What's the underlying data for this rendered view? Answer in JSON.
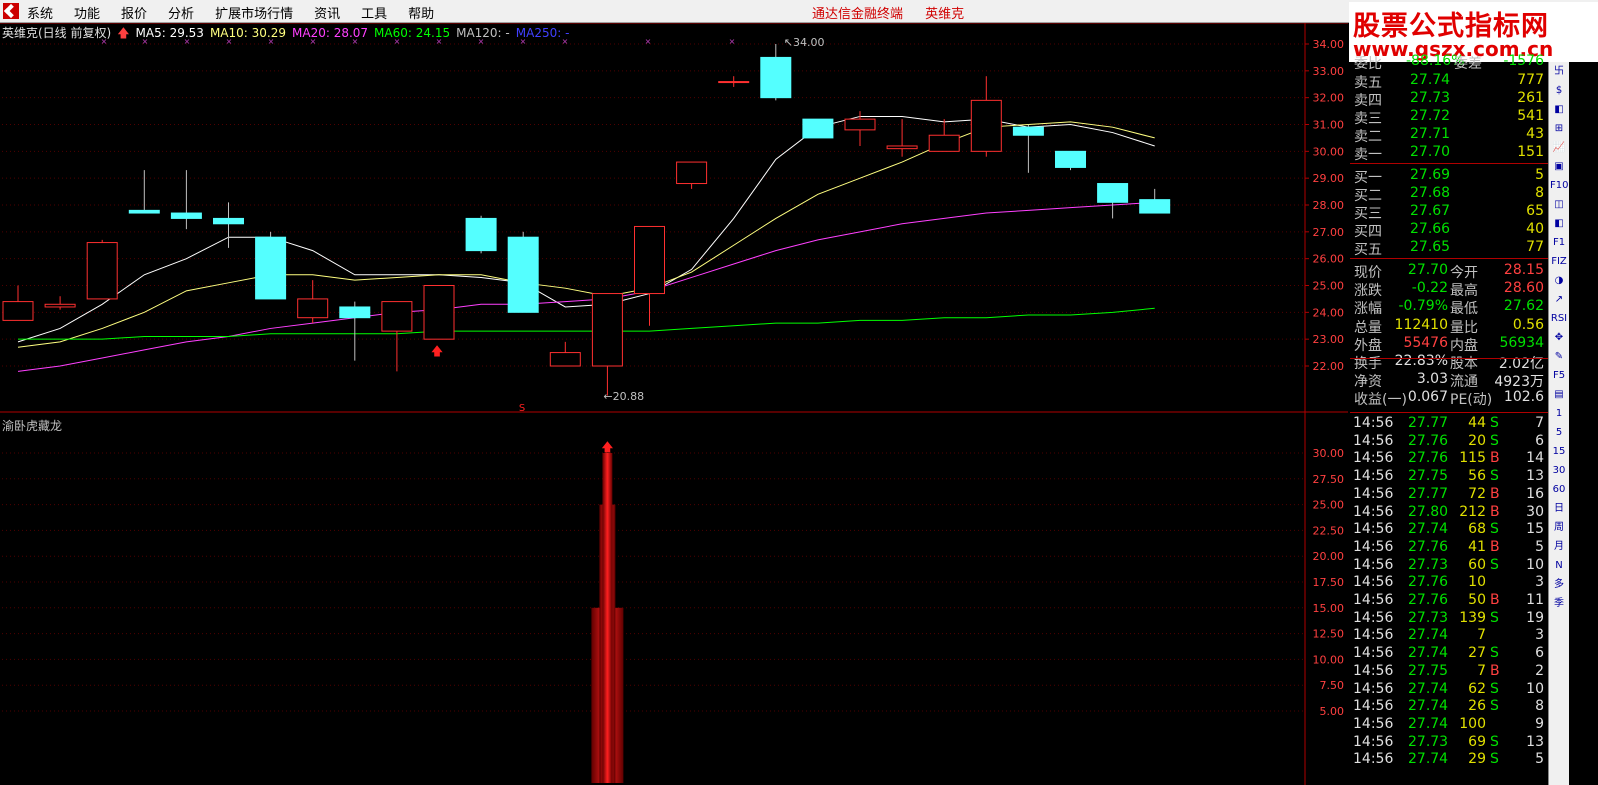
{
  "menu": {
    "items": [
      "系统",
      "功能",
      "报价",
      "分析",
      "扩展市场行情",
      "资讯",
      "工具",
      "帮助"
    ],
    "center_title": "通达信金融终端",
    "stock_name": "英维克"
  },
  "brand": {
    "title": "股票公式指标网",
    "url": "www.gszx.com.cn"
  },
  "chart": {
    "header": "英维克(日线 前复权)",
    "ma": [
      {
        "label": "MA5: 29.53",
        "color": "#ffffff"
      },
      {
        "label": "MA10: 30.29",
        "color": "#ffff80"
      },
      {
        "label": "MA20: 28.07",
        "color": "#ff40ff"
      },
      {
        "label": "MA60: 24.15",
        "color": "#00ff00"
      },
      {
        "label": "MA120: -",
        "color": "#c0c0c0"
      },
      {
        "label": "MA250: -",
        "color": "#4040ff"
      }
    ],
    "price_axis": [
      "34.00",
      "33.00",
      "32.00",
      "31.00",
      "30.00",
      "29.00",
      "28.00",
      "27.00",
      "26.00",
      "25.00",
      "24.00",
      "23.00",
      "22.00"
    ],
    "high_label": "34.00",
    "low_label": "20.88",
    "indicator_title": "渝卧虎藏龙",
    "indicator_axis": [
      "30.00",
      "27.50",
      "25.00",
      "22.50",
      "20.00",
      "17.50",
      "15.00",
      "12.50",
      "10.00",
      "7.50",
      "5.00"
    ]
  },
  "chart_data": {
    "type": "candlestick",
    "title": "英维克(日线 前复权)",
    "ylim": [
      21.0,
      34.5
    ],
    "candles": [
      {
        "o": 23.7,
        "c": 24.4,
        "h": 25.0,
        "l": 23.7
      },
      {
        "o": 24.2,
        "c": 24.3,
        "h": 24.6,
        "l": 24.1
      },
      {
        "o": 24.5,
        "c": 26.6,
        "h": 26.7,
        "l": 24.5
      },
      {
        "o": 27.8,
        "c": 27.7,
        "h": 29.3,
        "l": 27.7
      },
      {
        "o": 27.7,
        "c": 27.5,
        "h": 29.3,
        "l": 27.1
      },
      {
        "o": 27.5,
        "c": 27.3,
        "h": 28.1,
        "l": 26.4
      },
      {
        "o": 26.8,
        "c": 24.5,
        "h": 27.0,
        "l": 24.5
      },
      {
        "o": 23.8,
        "c": 24.5,
        "h": 25.2,
        "l": 23.6
      },
      {
        "o": 24.2,
        "c": 23.8,
        "h": 24.4,
        "l": 22.2
      },
      {
        "o": 23.3,
        "c": 24.4,
        "h": 24.4,
        "l": 21.8
      },
      {
        "o": 23.0,
        "c": 25.0,
        "h": 25.0,
        "l": 23.0
      },
      {
        "o": 27.5,
        "c": 26.3,
        "h": 27.6,
        "l": 26.2
      },
      {
        "o": 26.8,
        "c": 24.0,
        "h": 27.0,
        "l": 24.0
      },
      {
        "o": 22.0,
        "c": 22.5,
        "h": 22.9,
        "l": 22.0
      },
      {
        "o": 22.0,
        "c": 24.7,
        "h": 24.7,
        "l": 20.9
      },
      {
        "o": 24.7,
        "c": 27.2,
        "h": 27.2,
        "l": 23.5
      },
      {
        "o": 28.8,
        "c": 29.6,
        "h": 29.6,
        "l": 28.6
      },
      {
        "o": 32.6,
        "c": 32.6,
        "h": 32.8,
        "l": 32.4
      },
      {
        "o": 33.5,
        "c": 32.0,
        "h": 34.0,
        "l": 31.9
      },
      {
        "o": 31.2,
        "c": 30.5,
        "h": 31.2,
        "l": 30.5
      },
      {
        "o": 30.8,
        "c": 31.2,
        "h": 31.5,
        "l": 30.2
      },
      {
        "o": 30.1,
        "c": 30.2,
        "h": 31.2,
        "l": 29.8
      },
      {
        "o": 30.0,
        "c": 30.6,
        "h": 31.2,
        "l": 30.0
      },
      {
        "o": 30.0,
        "c": 31.9,
        "h": 32.8,
        "l": 29.8
      },
      {
        "o": 30.9,
        "c": 30.6,
        "h": 31.0,
        "l": 29.2
      },
      {
        "o": 30.0,
        "c": 29.4,
        "h": 30.0,
        "l": 29.3
      },
      {
        "o": 28.8,
        "c": 28.1,
        "h": 28.8,
        "l": 27.5
      },
      {
        "o": 28.2,
        "c": 27.7,
        "h": 28.6,
        "l": 27.7
      }
    ],
    "ma5": [
      22.9,
      23.4,
      24.3,
      25.4,
      26.0,
      26.8,
      26.8,
      26.3,
      25.4,
      25.4,
      25.4,
      25.3,
      25.1,
      24.2,
      24.3,
      24.7,
      25.6,
      27.5,
      29.7,
      30.9,
      31.3,
      31.3,
      31.1,
      31.2,
      30.9,
      31.0,
      30.7,
      30.2
    ],
    "ma10": [
      22.7,
      22.9,
      23.4,
      24.0,
      24.8,
      25.1,
      25.4,
      25.4,
      25.2,
      25.3,
      25.4,
      25.4,
      25.1,
      24.9,
      24.6,
      24.9,
      25.5,
      26.5,
      27.5,
      28.4,
      29.0,
      29.6,
      30.3,
      30.9,
      31.0,
      31.1,
      30.9,
      30.5
    ],
    "ma20": [
      21.8,
      22.0,
      22.3,
      22.6,
      22.9,
      23.1,
      23.4,
      23.6,
      23.8,
      24.0,
      24.1,
      24.3,
      24.3,
      24.4,
      24.5,
      24.8,
      25.3,
      25.8,
      26.3,
      26.7,
      27.0,
      27.3,
      27.5,
      27.7,
      27.8,
      27.9,
      28.0,
      28.1
    ],
    "ma60": [
      23.0,
      23.0,
      23.0,
      23.1,
      23.1,
      23.1,
      23.2,
      23.2,
      23.2,
      23.2,
      23.3,
      23.3,
      23.3,
      23.3,
      23.3,
      23.3,
      23.4,
      23.5,
      23.6,
      23.6,
      23.7,
      23.7,
      23.8,
      23.8,
      23.9,
      23.9,
      24.0,
      24.15
    ]
  },
  "quote": {
    "header_left": "委比",
    "header_left_val": "-88.16%",
    "header_right": "委差",
    "header_right_val": "-1576",
    "sells": [
      {
        "label": "卖五",
        "price": "27.74",
        "vol": "777"
      },
      {
        "label": "卖四",
        "price": "27.73",
        "vol": "261"
      },
      {
        "label": "卖三",
        "price": "27.72",
        "vol": "541"
      },
      {
        "label": "卖二",
        "price": "27.71",
        "vol": "43"
      },
      {
        "label": "卖一",
        "price": "27.70",
        "vol": "151"
      }
    ],
    "buys": [
      {
        "label": "买一",
        "price": "27.69",
        "vol": "5"
      },
      {
        "label": "买二",
        "price": "27.68",
        "vol": "8"
      },
      {
        "label": "买三",
        "price": "27.67",
        "vol": "65"
      },
      {
        "label": "买四",
        "price": "27.66",
        "vol": "40"
      },
      {
        "label": "买五",
        "price": "27.65",
        "vol": "77"
      }
    ],
    "stats": [
      {
        "l1": "现价",
        "v1": "27.70",
        "l2": "今开",
        "v2": "28.15",
        "c1": "#00e000",
        "c2": "#ff4040"
      },
      {
        "l1": "涨跌",
        "v1": "-0.22",
        "l2": "最高",
        "v2": "28.60",
        "c1": "#00e000",
        "c2": "#ff4040"
      },
      {
        "l1": "涨幅",
        "v1": "-0.79%",
        "l2": "最低",
        "v2": "27.62",
        "c1": "#00e000",
        "c2": "#00e000"
      },
      {
        "l1": "总量",
        "v1": "112410",
        "l2": "量比",
        "v2": "0.56",
        "c1": "#e0e000",
        "c2": "#e0e000"
      },
      {
        "l1": "外盘",
        "v1": "55476",
        "l2": "内盘",
        "v2": "56934",
        "c1": "#ff4040",
        "c2": "#00e000"
      },
      {
        "l1": "换手",
        "v1": "22.83%",
        "l2": "股本",
        "v2": "2.02亿",
        "c1": "#e0e0e0",
        "c2": "#e0e0e0"
      },
      {
        "l1": "净资",
        "v1": "3.03",
        "l2": "流通",
        "v2": "4923万",
        "c1": "#e0e0e0",
        "c2": "#e0e0e0"
      },
      {
        "l1": "收益(一)",
        "v1": "0.067",
        "l2": "PE(动)",
        "v2": "102.6",
        "c1": "#e0e0e0",
        "c2": "#e0e0e0"
      }
    ]
  },
  "ticks": [
    {
      "t": "14:56",
      "p": "27.77",
      "v": "44",
      "bs": "S",
      "n": "7"
    },
    {
      "t": "14:56",
      "p": "27.76",
      "v": "20",
      "bs": "S",
      "n": "6"
    },
    {
      "t": "14:56",
      "p": "27.76",
      "v": "115",
      "bs": "B",
      "n": "14"
    },
    {
      "t": "14:56",
      "p": "27.75",
      "v": "56",
      "bs": "S",
      "n": "13"
    },
    {
      "t": "14:56",
      "p": "27.77",
      "v": "72",
      "bs": "B",
      "n": "16"
    },
    {
      "t": "14:56",
      "p": "27.80",
      "v": "212",
      "bs": "B",
      "n": "30"
    },
    {
      "t": "14:56",
      "p": "27.74",
      "v": "68",
      "bs": "S",
      "n": "15"
    },
    {
      "t": "14:56",
      "p": "27.76",
      "v": "41",
      "bs": "B",
      "n": "5"
    },
    {
      "t": "14:56",
      "p": "27.73",
      "v": "60",
      "bs": "S",
      "n": "10"
    },
    {
      "t": "14:56",
      "p": "27.76",
      "v": "10",
      "bs": "",
      "n": "3"
    },
    {
      "t": "14:56",
      "p": "27.76",
      "v": "50",
      "bs": "B",
      "n": "11"
    },
    {
      "t": "14:56",
      "p": "27.73",
      "v": "139",
      "bs": "S",
      "n": "19"
    },
    {
      "t": "14:56",
      "p": "27.74",
      "v": "7",
      "bs": "",
      "n": "3"
    },
    {
      "t": "14:56",
      "p": "27.74",
      "v": "27",
      "bs": "S",
      "n": "6"
    },
    {
      "t": "14:56",
      "p": "27.75",
      "v": "7",
      "bs": "B",
      "n": "2"
    },
    {
      "t": "14:56",
      "p": "27.74",
      "v": "62",
      "bs": "S",
      "n": "10"
    },
    {
      "t": "14:56",
      "p": "27.74",
      "v": "26",
      "bs": "S",
      "n": "8"
    },
    {
      "t": "14:56",
      "p": "27.74",
      "v": "100",
      "bs": "",
      "n": "9"
    },
    {
      "t": "14:56",
      "p": "27.73",
      "v": "69",
      "bs": "S",
      "n": "13"
    },
    {
      "t": "14:56",
      "p": "27.74",
      "v": "29",
      "bs": "S",
      "n": "5"
    }
  ],
  "toolbar": [
    "卐",
    "$",
    "◧",
    "⊞",
    "📈",
    "▣",
    "F10",
    "◫",
    "◧",
    "F1",
    "FIZ",
    "◑",
    "↗",
    "RSI",
    "✥",
    "✎",
    "F5",
    "▤",
    "1",
    "5",
    "15",
    "30",
    "60",
    "日",
    "周",
    "月",
    "N",
    "多",
    "季"
  ]
}
